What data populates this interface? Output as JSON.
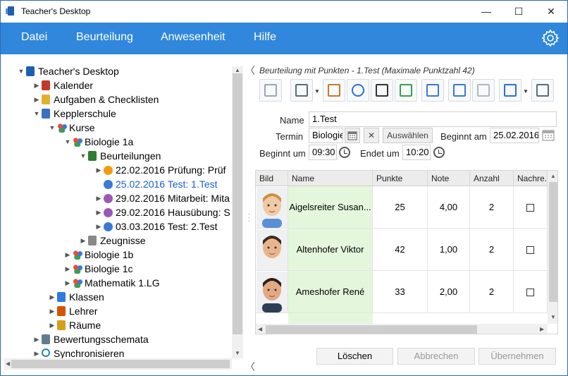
{
  "window": {
    "title": "Teacher's Desktop",
    "minimize": "—",
    "maximize": "☐",
    "close": "✕"
  },
  "menu": {
    "items": [
      "Datei",
      "Beurteilung",
      "Anwesenheit",
      "Hilfe"
    ]
  },
  "tree": {
    "nodes": [
      {
        "label": "Teacher's Desktop",
        "icon": "app-icon",
        "twisty": "▼"
      },
      {
        "label": "Kalender",
        "icon": "calendar-icon",
        "twisty": "▶"
      },
      {
        "label": "Aufgaben & Checklisten",
        "icon": "checklist-icon",
        "twisty": "▶"
      },
      {
        "label": "Kepplerschule",
        "icon": "school-icon",
        "twisty": "▼"
      },
      {
        "label": "Kurse",
        "icon": "courses-icon",
        "twisty": "▼"
      },
      {
        "label": "Biologie 1a",
        "icon": "course-icon",
        "twisty": "▼"
      },
      {
        "label": "Beurteilungen",
        "icon": "assessments-icon",
        "twisty": "▼"
      },
      {
        "label": "22.02.2016 Prüfung: Prüf",
        "icon": "orange-dot-icon",
        "twisty": "▶"
      },
      {
        "label": "25.02.2016 Test: 1.Test",
        "icon": "blue-dot-icon",
        "twisty": "",
        "selected": true
      },
      {
        "label": "29.02.2016 Mitarbeit: Mita",
        "icon": "purple-dot-icon",
        "twisty": "▶"
      },
      {
        "label": "29.02.2016 Hausübung: S",
        "icon": "purple-dot-icon",
        "twisty": "▶"
      },
      {
        "label": "03.03.2016 Test: 2.Test",
        "icon": "blue-dot-icon",
        "twisty": "▶"
      },
      {
        "label": "Zeugnisse",
        "icon": "report-icon",
        "twisty": "▶"
      },
      {
        "label": "Biologie 1b",
        "icon": "course-icon",
        "twisty": "▶"
      },
      {
        "label": "Biologie 1c",
        "icon": "course-icon",
        "twisty": "▶"
      },
      {
        "label": "Mathematik 1.LG",
        "icon": "course-icon",
        "twisty": "▶"
      },
      {
        "label": "Klassen",
        "icon": "classes-icon",
        "twisty": "▶"
      },
      {
        "label": "Lehrer",
        "icon": "teacher-icon",
        "twisty": "▶"
      },
      {
        "label": "Räume",
        "icon": "rooms-icon",
        "twisty": "▶"
      },
      {
        "label": "Bewertungsschemata",
        "icon": "calculator-icon",
        "twisty": "▶"
      },
      {
        "label": "Synchronisieren",
        "icon": "sync-icon",
        "twisty": "▶"
      }
    ]
  },
  "panel": {
    "title": "Beurteilung mit Punkten - 1.Test (Maximale Punktzahl 42)",
    "toolbar": [
      "list-icon",
      "printer-icon",
      "keyboard-icon",
      "clock-icon",
      "dice-icon",
      "grade-chart-icon",
      "bar-chart-icon",
      "table-icon",
      "document-icon",
      "person-icon",
      "calculator-icon"
    ],
    "form": {
      "name_label": "Name",
      "name_value": "1.Test",
      "termin_label": "Termin",
      "termin_value": "Biologie",
      "auswaehlen": "Auswählen",
      "beginnt_am_label": "Beginnt am",
      "beginnt_am_value": "25.02.2016",
      "beginnt_um_label": "Beginnt um",
      "beginnt_um_value": "09:30",
      "endet_um_label": "Endet um",
      "endet_um_value": "10:20"
    },
    "grid": {
      "headers": [
        "Bild",
        "Name",
        "Punkte",
        "Note",
        "Anzahl",
        "Nachre..."
      ],
      "rows": [
        {
          "name": "Aigelsreiter Susan...",
          "punkte": "25",
          "note": "4,00",
          "anzahl": "2"
        },
        {
          "name": "Altenhofer Viktor",
          "punkte": "42",
          "note": "1,00",
          "anzahl": "2"
        },
        {
          "name": "Ameshofer René",
          "punkte": "33",
          "note": "2,00",
          "anzahl": "2"
        }
      ]
    },
    "buttons": {
      "loeschen": "Löschen",
      "abbrechen": "Abbrechen",
      "uebernehmen": "Übernehmen"
    }
  }
}
